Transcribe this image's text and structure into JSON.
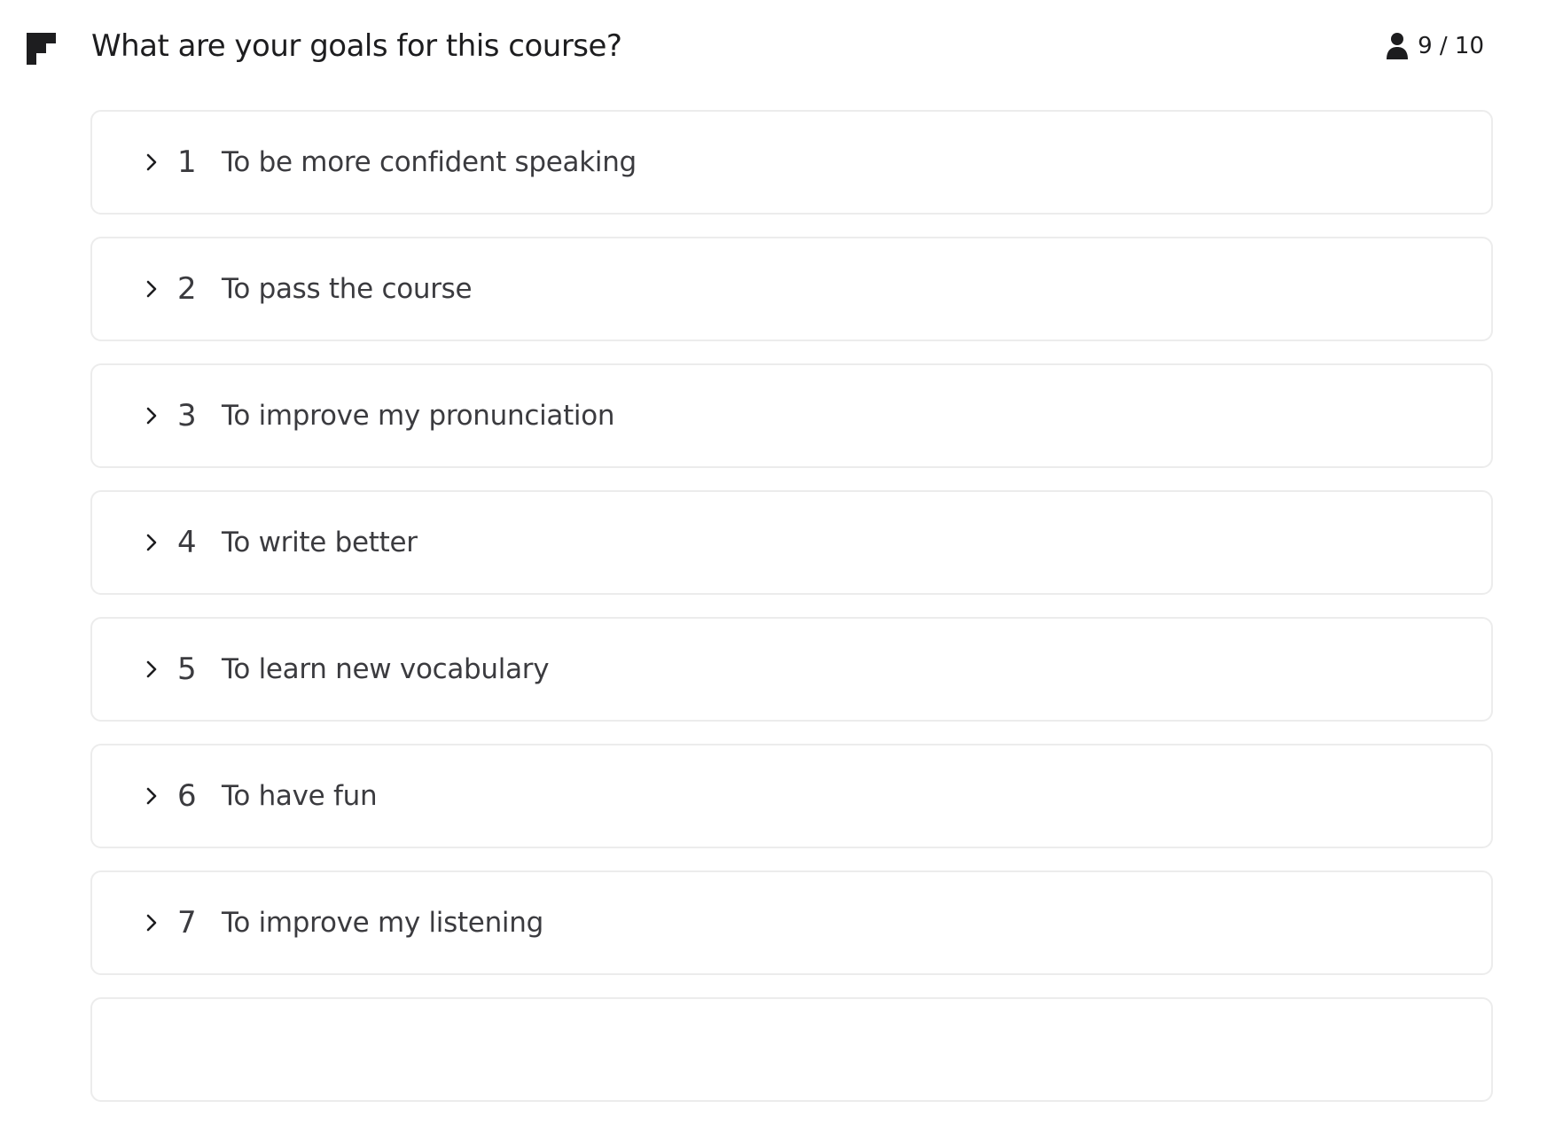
{
  "header": {
    "title": "What are your goals for this course?",
    "counter": "9 / 10",
    "logo_icon": "brand-logo-icon",
    "counter_icon": "person-icon"
  },
  "options": [
    {
      "number": "1",
      "label": "To be more confident speaking"
    },
    {
      "number": "2",
      "label": "To pass the course"
    },
    {
      "number": "3",
      "label": "To improve my pronunciation"
    },
    {
      "number": "4",
      "label": "To write better"
    },
    {
      "number": "5",
      "label": "To learn new vocabulary"
    },
    {
      "number": "6",
      "label": "To have fun"
    },
    {
      "number": "7",
      "label": "To improve my listening"
    }
  ],
  "colors": {
    "text": "#1d1d1f",
    "item_text": "#3b3b3f",
    "border": "#ececec"
  }
}
